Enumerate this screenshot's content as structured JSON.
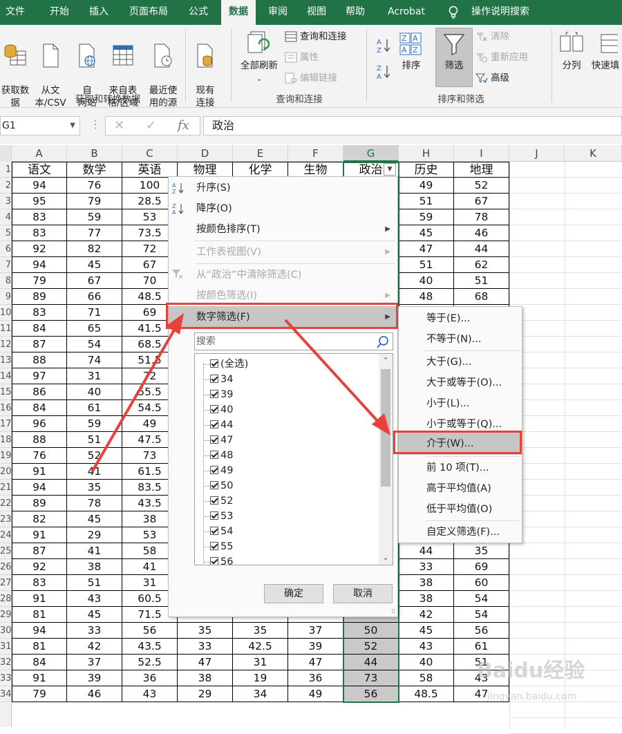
{
  "menubar": {
    "tabs": [
      "文件",
      "开始",
      "插入",
      "页面布局",
      "公式",
      "数据",
      "审阅",
      "视图",
      "帮助",
      "Acrobat"
    ],
    "active": "数据",
    "tell_me": "操作说明搜索"
  },
  "ribbon": {
    "get_data_label": "获取数\n据",
    "get_data_dd": "⌄",
    "from_csv": "从文\n本/CSV",
    "from_web": "自\n网站",
    "from_table": "来自表\n格/区域",
    "recent_sources": "最近使\n用的源",
    "existing_conn": "现有\n连接",
    "group1_label": "获取和转换数据",
    "refresh_all": "全部刷新",
    "queries_conn": "查询和连接",
    "properties": "属性",
    "edit_links": "编辑链接",
    "group2_label": "查询和连接",
    "sort": "排序",
    "filter": "筛选",
    "clear": "清除",
    "reapply": "重新应用",
    "advanced": "高级",
    "group3_label": "排序和筛选",
    "split": "分列",
    "flash_fill": "快速填"
  },
  "formula_bar": {
    "name_box": "G1",
    "formula": "政治"
  },
  "grid": {
    "columns": [
      "A",
      "B",
      "C",
      "D",
      "E",
      "F",
      "G",
      "H",
      "I",
      "J",
      "K"
    ],
    "row_numbers": [
      "1",
      "2",
      "3",
      "4",
      "5",
      "6",
      "7",
      "8",
      "9",
      "10",
      "11",
      "12",
      "13",
      "14",
      "15",
      "16",
      "17",
      "18",
      "19",
      "20",
      "21",
      "22",
      "23",
      "24",
      "25",
      "26",
      "27",
      "28",
      "29",
      "30",
      "31",
      "32",
      "33",
      "34"
    ],
    "headers": [
      "语文",
      "数学",
      "英语",
      "物理",
      "化学",
      "生物",
      "政治",
      "历史",
      "地理"
    ],
    "rows": [
      [
        "94",
        "76",
        "100",
        "",
        "",
        "",
        "",
        "49",
        "52"
      ],
      [
        "95",
        "79",
        "28.5",
        "",
        "",
        "",
        "",
        "51",
        "67"
      ],
      [
        "83",
        "59",
        "53",
        "",
        "",
        "",
        "",
        "59",
        "78"
      ],
      [
        "83",
        "77",
        "73.5",
        "",
        "",
        "",
        "",
        "45",
        "46"
      ],
      [
        "92",
        "82",
        "72",
        "",
        "",
        "",
        "",
        "47",
        "44"
      ],
      [
        "94",
        "45",
        "67",
        "",
        "",
        "",
        "",
        "51",
        "62"
      ],
      [
        "79",
        "67",
        "70",
        "",
        "",
        "",
        "",
        "40",
        "51"
      ],
      [
        "89",
        "66",
        "48.5",
        "",
        "",
        "",
        "",
        "48",
        "68"
      ],
      [
        "83",
        "71",
        "69",
        "",
        "",
        "",
        "",
        "",
        ""
      ],
      [
        "84",
        "65",
        "41.5",
        "",
        "",
        "",
        "",
        "",
        ""
      ],
      [
        "87",
        "54",
        "68.5",
        "",
        "",
        "",
        "",
        "",
        ""
      ],
      [
        "88",
        "74",
        "51.5",
        "",
        "",
        "",
        "",
        "",
        ""
      ],
      [
        "97",
        "31",
        "72",
        "",
        "",
        "",
        "",
        "",
        ""
      ],
      [
        "86",
        "40",
        "55.5",
        "",
        "",
        "",
        "",
        "",
        ""
      ],
      [
        "84",
        "61",
        "54.5",
        "",
        "",
        "",
        "",
        "",
        ""
      ],
      [
        "96",
        "59",
        "49",
        "",
        "",
        "",
        "",
        "",
        ""
      ],
      [
        "88",
        "51",
        "47.5",
        "",
        "",
        "",
        "",
        "",
        ""
      ],
      [
        "76",
        "52",
        "73",
        "",
        "",
        "",
        "",
        "",
        ""
      ],
      [
        "91",
        "41",
        "61.5",
        "",
        "",
        "",
        "",
        "",
        ""
      ],
      [
        "94",
        "35",
        "83.5",
        "",
        "",
        "",
        "",
        "",
        ""
      ],
      [
        "89",
        "78",
        "43.5",
        "",
        "",
        "",
        "",
        "",
        ""
      ],
      [
        "82",
        "45",
        "38",
        "",
        "",
        "",
        "",
        "",
        ""
      ],
      [
        "91",
        "29",
        "53",
        "",
        "",
        "",
        "",
        "",
        ""
      ],
      [
        "87",
        "41",
        "58",
        "",
        "",
        "",
        "",
        "44",
        "35"
      ],
      [
        "92",
        "38",
        "41",
        "",
        "",
        "",
        "",
        "33",
        "69"
      ],
      [
        "83",
        "51",
        "31",
        "",
        "",
        "",
        "",
        "38",
        "60"
      ],
      [
        "91",
        "43",
        "60.5",
        "",
        "",
        "",
        "",
        "38",
        "54"
      ],
      [
        "81",
        "45",
        "71.5",
        "",
        "",
        "",
        "",
        "42",
        "54"
      ],
      [
        "94",
        "33",
        "56",
        "35",
        "35",
        "37",
        "50",
        "45",
        "56"
      ],
      [
        "81",
        "42",
        "43.5",
        "33",
        "42.5",
        "39",
        "52",
        "43",
        "61"
      ],
      [
        "84",
        "37",
        "52.5",
        "47",
        "31",
        "47",
        "44",
        "40",
        "51"
      ],
      [
        "91",
        "39",
        "36",
        "38",
        "19",
        "36",
        "73",
        "58",
        "43"
      ],
      [
        "79",
        "46",
        "43",
        "29",
        "34",
        "49",
        "56",
        "48.5",
        "47"
      ]
    ]
  },
  "dropdown": {
    "sort_asc": "升序(S)",
    "sort_desc": "降序(O)",
    "sort_by_color": "按颜色排序(T)",
    "sheet_view": "工作表视图(V)",
    "clear_filter": "从“政治”中清除筛选(C)",
    "filter_by_color": "按颜色筛选(I)",
    "number_filters": "数字筛选(F)",
    "search_placeholder": "搜索",
    "list_items": [
      "(全选)",
      "34",
      "39",
      "40",
      "44",
      "47",
      "48",
      "49",
      "50",
      "52",
      "53",
      "54",
      "55",
      "56"
    ],
    "ok": "确定",
    "cancel": "取消"
  },
  "submenu": {
    "items": [
      "等于(E)...",
      "不等于(N)...",
      "大于(G)...",
      "大于或等于(O)...",
      "小于(L)...",
      "小于或等于(Q)...",
      "介于(W)...",
      "前 10 项(T)...",
      "高于平均值(A)",
      "低于平均值(O)",
      "自定义筛选(F)..."
    ]
  },
  "colors": {
    "excel_green": "#217346",
    "annotation_red": "#e8403a"
  },
  "watermark": {
    "text": "Baidu经验",
    "sub": "jingyan.baidu.com"
  }
}
